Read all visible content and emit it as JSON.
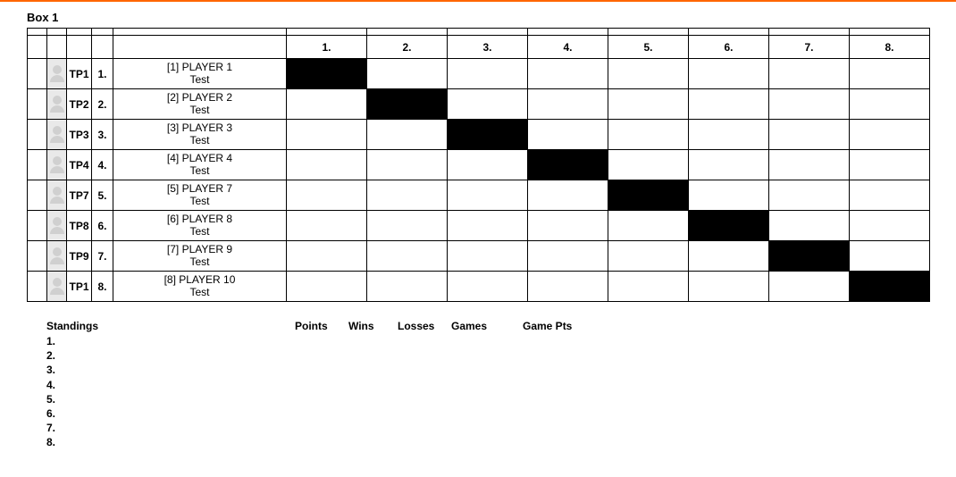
{
  "box_title": "Box 1",
  "columns": [
    "1.",
    "2.",
    "3.",
    "4.",
    "5.",
    "6.",
    "7.",
    "8."
  ],
  "players": [
    {
      "code": "TP1",
      "num": "1.",
      "seed_name": "[1] PLAYER 1",
      "line2": "Test"
    },
    {
      "code": "TP2",
      "num": "2.",
      "seed_name": "[2] PLAYER 2",
      "line2": "Test"
    },
    {
      "code": "TP3",
      "num": "3.",
      "seed_name": "[3] PLAYER 3",
      "line2": "Test"
    },
    {
      "code": "TP4",
      "num": "4.",
      "seed_name": "[4] PLAYER 4",
      "line2": "Test"
    },
    {
      "code": "TP7",
      "num": "5.",
      "seed_name": "[5] PLAYER 7",
      "line2": "Test"
    },
    {
      "code": "TP8",
      "num": "6.",
      "seed_name": "[6] PLAYER 8",
      "line2": "Test"
    },
    {
      "code": "TP9",
      "num": "7.",
      "seed_name": "[7] PLAYER 9",
      "line2": "Test"
    },
    {
      "code": "TP1",
      "num": "8.",
      "seed_name": "[8] PLAYER 10",
      "line2": "Test"
    }
  ],
  "standings": {
    "heading": "Standings",
    "rows": [
      "1.",
      "2.",
      "3.",
      "4.",
      "5.",
      "6.",
      "7.",
      "8."
    ],
    "col_points": "Points",
    "col_wins": "Wins",
    "col_losses": "Losses",
    "col_games": "Games",
    "col_gamepts": "Game Pts"
  }
}
